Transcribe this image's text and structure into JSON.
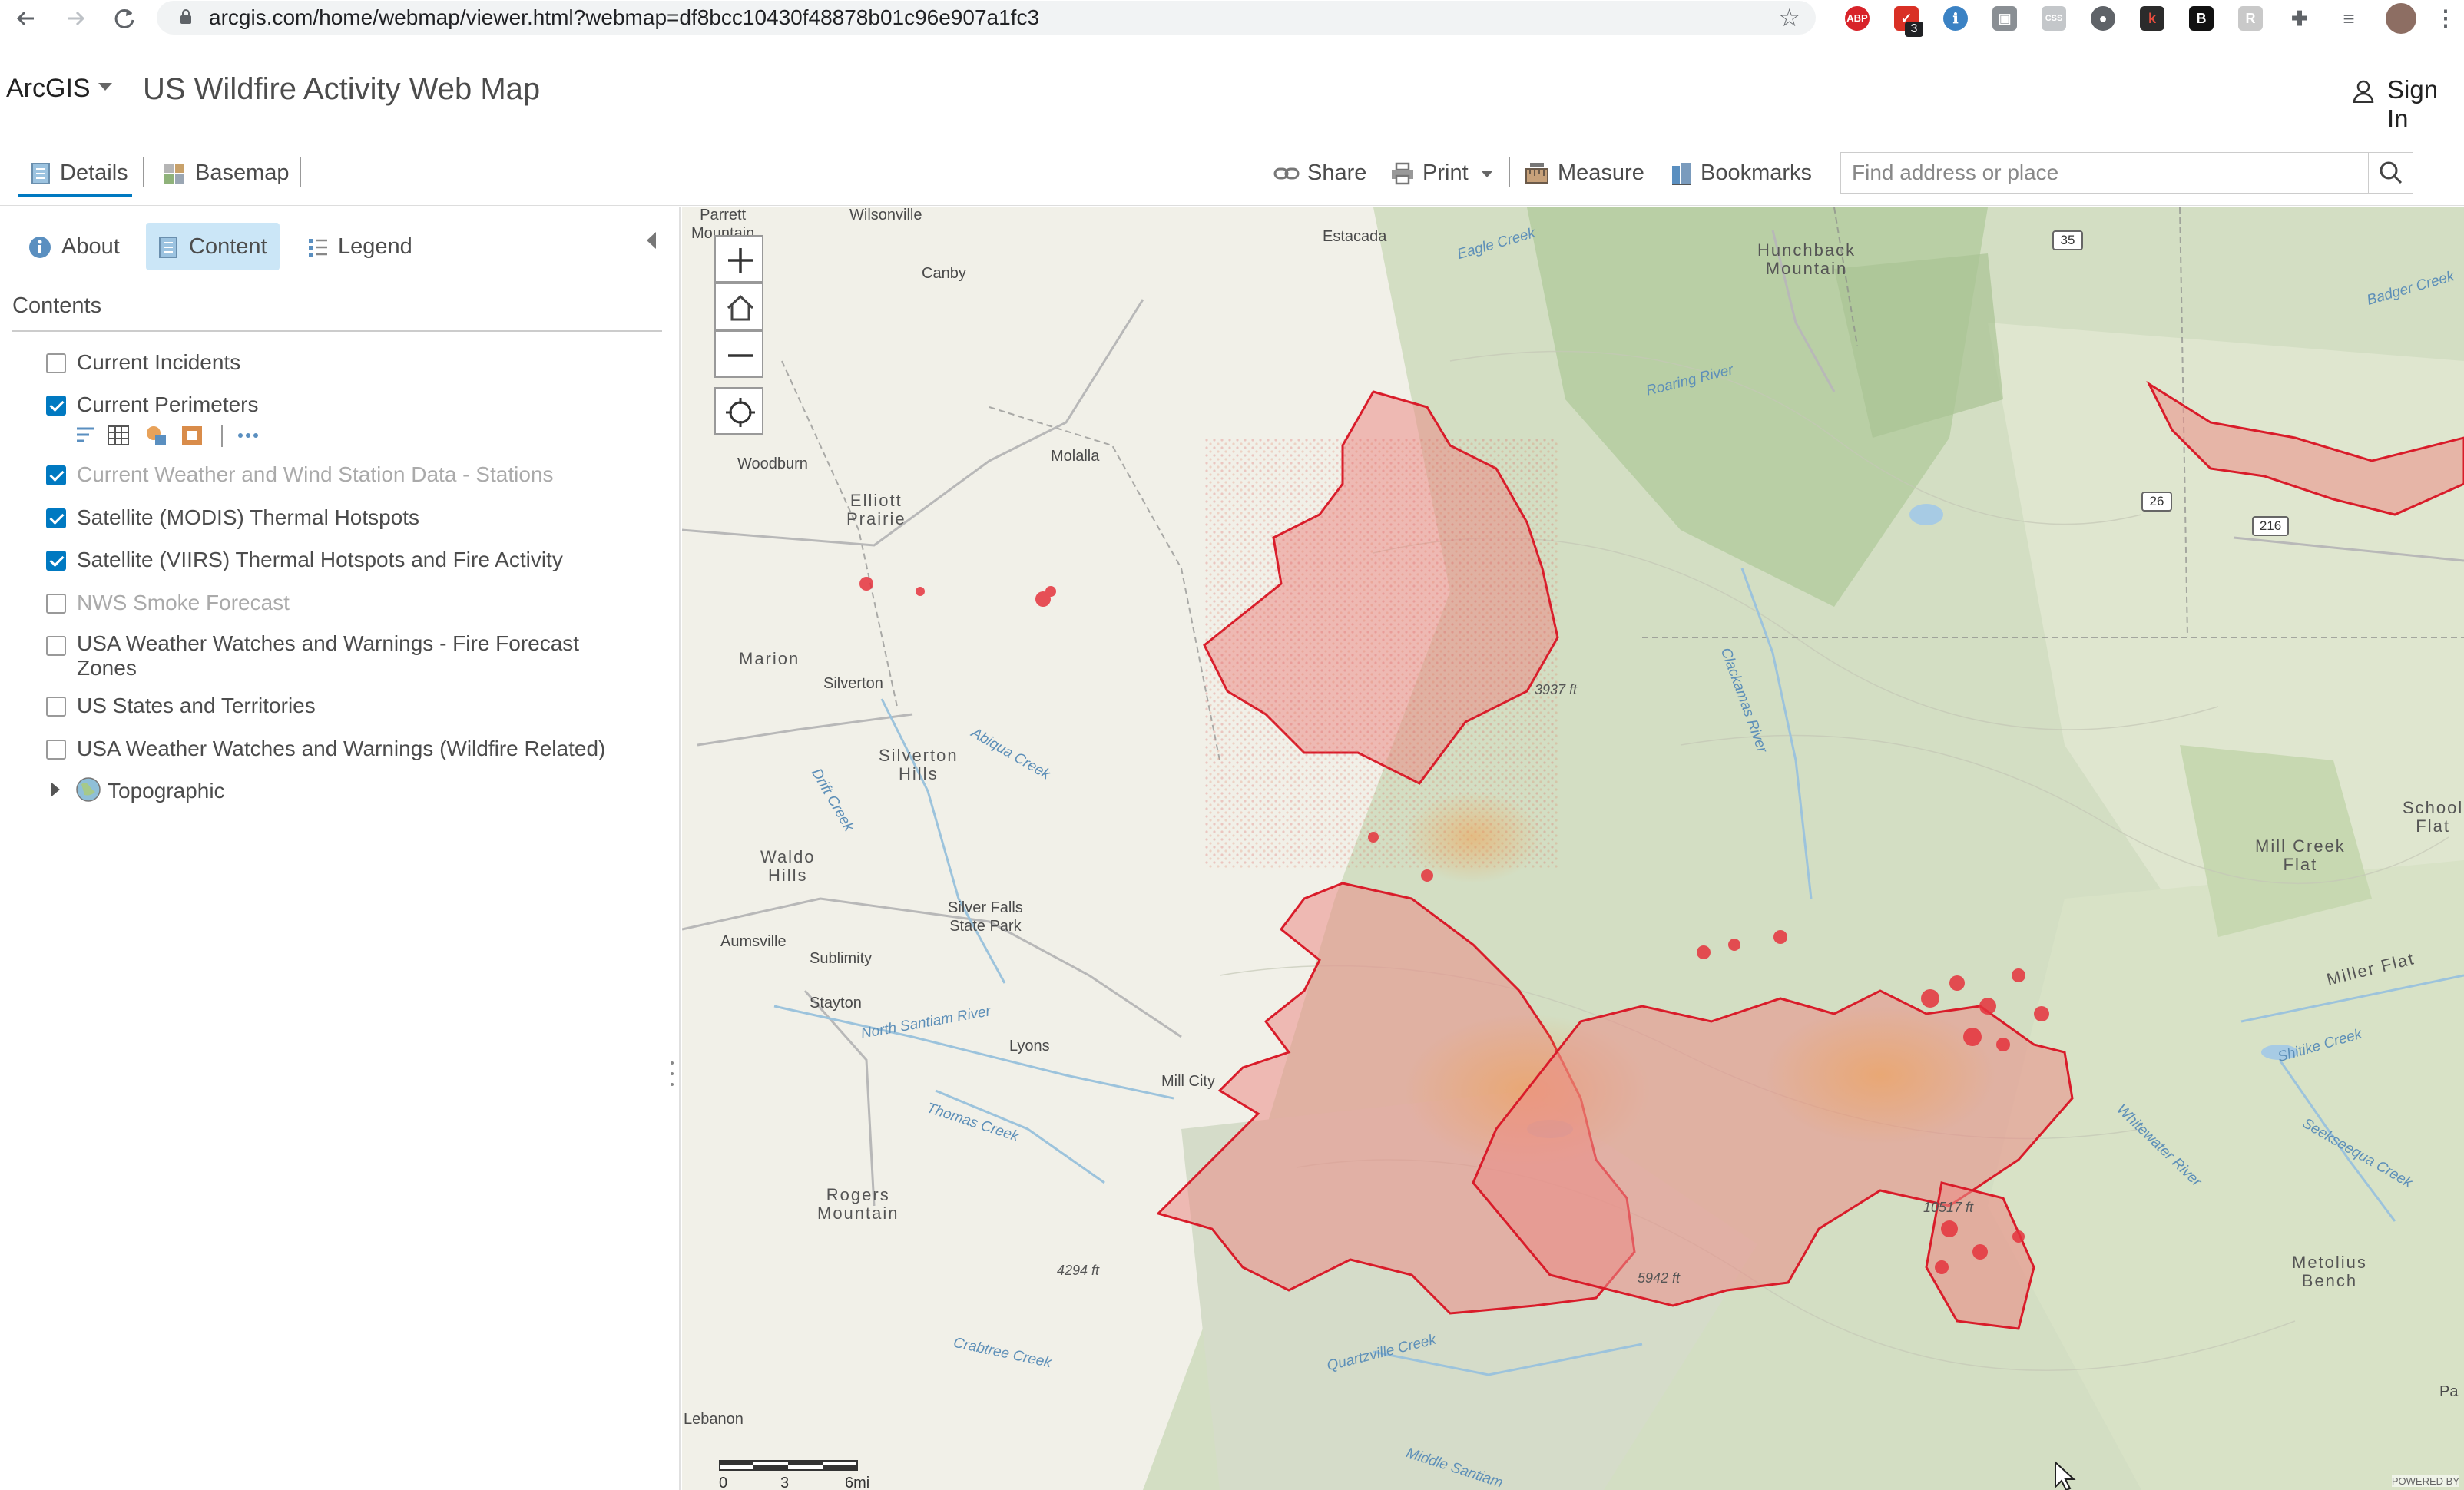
{
  "browser": {
    "url": "arcgis.com/home/webmap/viewer.html?webmap=df8bcc10430f48878b01c96e907a1fc3",
    "extension_badge": "3"
  },
  "header": {
    "brand": "ArcGIS",
    "title": "US Wildfire Activity Web Map",
    "sign_in": "Sign In"
  },
  "toolbar": {
    "details": "Details",
    "basemap": "Basemap",
    "share": "Share",
    "print": "Print",
    "measure": "Measure",
    "bookmarks": "Bookmarks",
    "search_placeholder": "Find address or place"
  },
  "panel": {
    "tabs": {
      "about": "About",
      "content": "Content",
      "legend": "Legend"
    },
    "contents_heading": "Contents",
    "layers": [
      {
        "label": "Current Incidents",
        "checked": false,
        "dimmed": false
      },
      {
        "label": "Current Perimeters",
        "checked": true,
        "dimmed": false
      },
      {
        "label": "Current Weather and Wind Station Data - Stations",
        "checked": true,
        "dimmed": true
      },
      {
        "label": "Satellite (MODIS) Thermal Hotspots",
        "checked": true,
        "dimmed": false
      },
      {
        "label": "Satellite (VIIRS) Thermal Hotspots and Fire Activity",
        "checked": true,
        "dimmed": false
      },
      {
        "label": "NWS Smoke Forecast",
        "checked": false,
        "dimmed": true
      },
      {
        "label": "USA Weather Watches and Warnings - Fire Forecast Zones",
        "checked": false,
        "dimmed": false
      },
      {
        "label": "US States and Territories",
        "checked": false,
        "dimmed": false
      },
      {
        "label": "USA Weather Watches and Warnings (Wildfire Related)",
        "checked": false,
        "dimmed": false
      }
    ],
    "basemap_layer": "Topographic"
  },
  "map": {
    "labels": {
      "parrett": "Parrett\nMountain",
      "wilsonville": "Wilsonville",
      "estacada": "Estacada",
      "canby": "Canby",
      "hunchback": "Hunchback\nMountain",
      "woodburn": "Woodburn",
      "molalla": "Molalla",
      "elliott": "Elliott\nPrairie",
      "marion": "Marion",
      "silverton": "Silverton",
      "silverton_hills": "Silverton\nHills",
      "waldo": "Waldo\nHills",
      "silver_falls": "Silver Falls\nState Park",
      "aumsville": "Aumsville",
      "sublimity": "Sublimity",
      "stayton": "Stayton",
      "lyons": "Lyons",
      "mill_city": "Mill City",
      "rogers": "Rogers\nMountain",
      "lebanon": "Lebanon",
      "mill_creek_flat": "Mill Creek\nFlat",
      "miller_flat": "Miller Flat",
      "metolius": "Metolius\nBench",
      "school_flat": "School\nFlat",
      "pa": "Pa"
    },
    "water_labels": {
      "eagle": "Eagle Creek",
      "roaring": "Roaring River",
      "clackamas": "Clackamas River",
      "abiqua": "Abiqua Creek",
      "drift": "Drift Creek",
      "north_santiam": "North Santiam River",
      "thomas": "Thomas Creek",
      "crabtree": "Crabtree Creek",
      "quartzville": "Quartzville Creek",
      "middle_santiam": "Middle Santiam",
      "badger": "Badger Creek",
      "shitike": "Shitike Creek",
      "whitewater": "Whitewater River",
      "seekseequa": "Seekseequa Creek"
    },
    "elevations": {
      "e1": "4294 ft",
      "e2": "5942 ft",
      "e3": "10517 ft",
      "e4": "3937 ft"
    },
    "shields": {
      "r35": "35",
      "r26": "26",
      "r216": "216"
    },
    "scale": {
      "zero": "0",
      "mid": "3",
      "end": "6mi"
    },
    "attribution": "POWERED BY"
  }
}
